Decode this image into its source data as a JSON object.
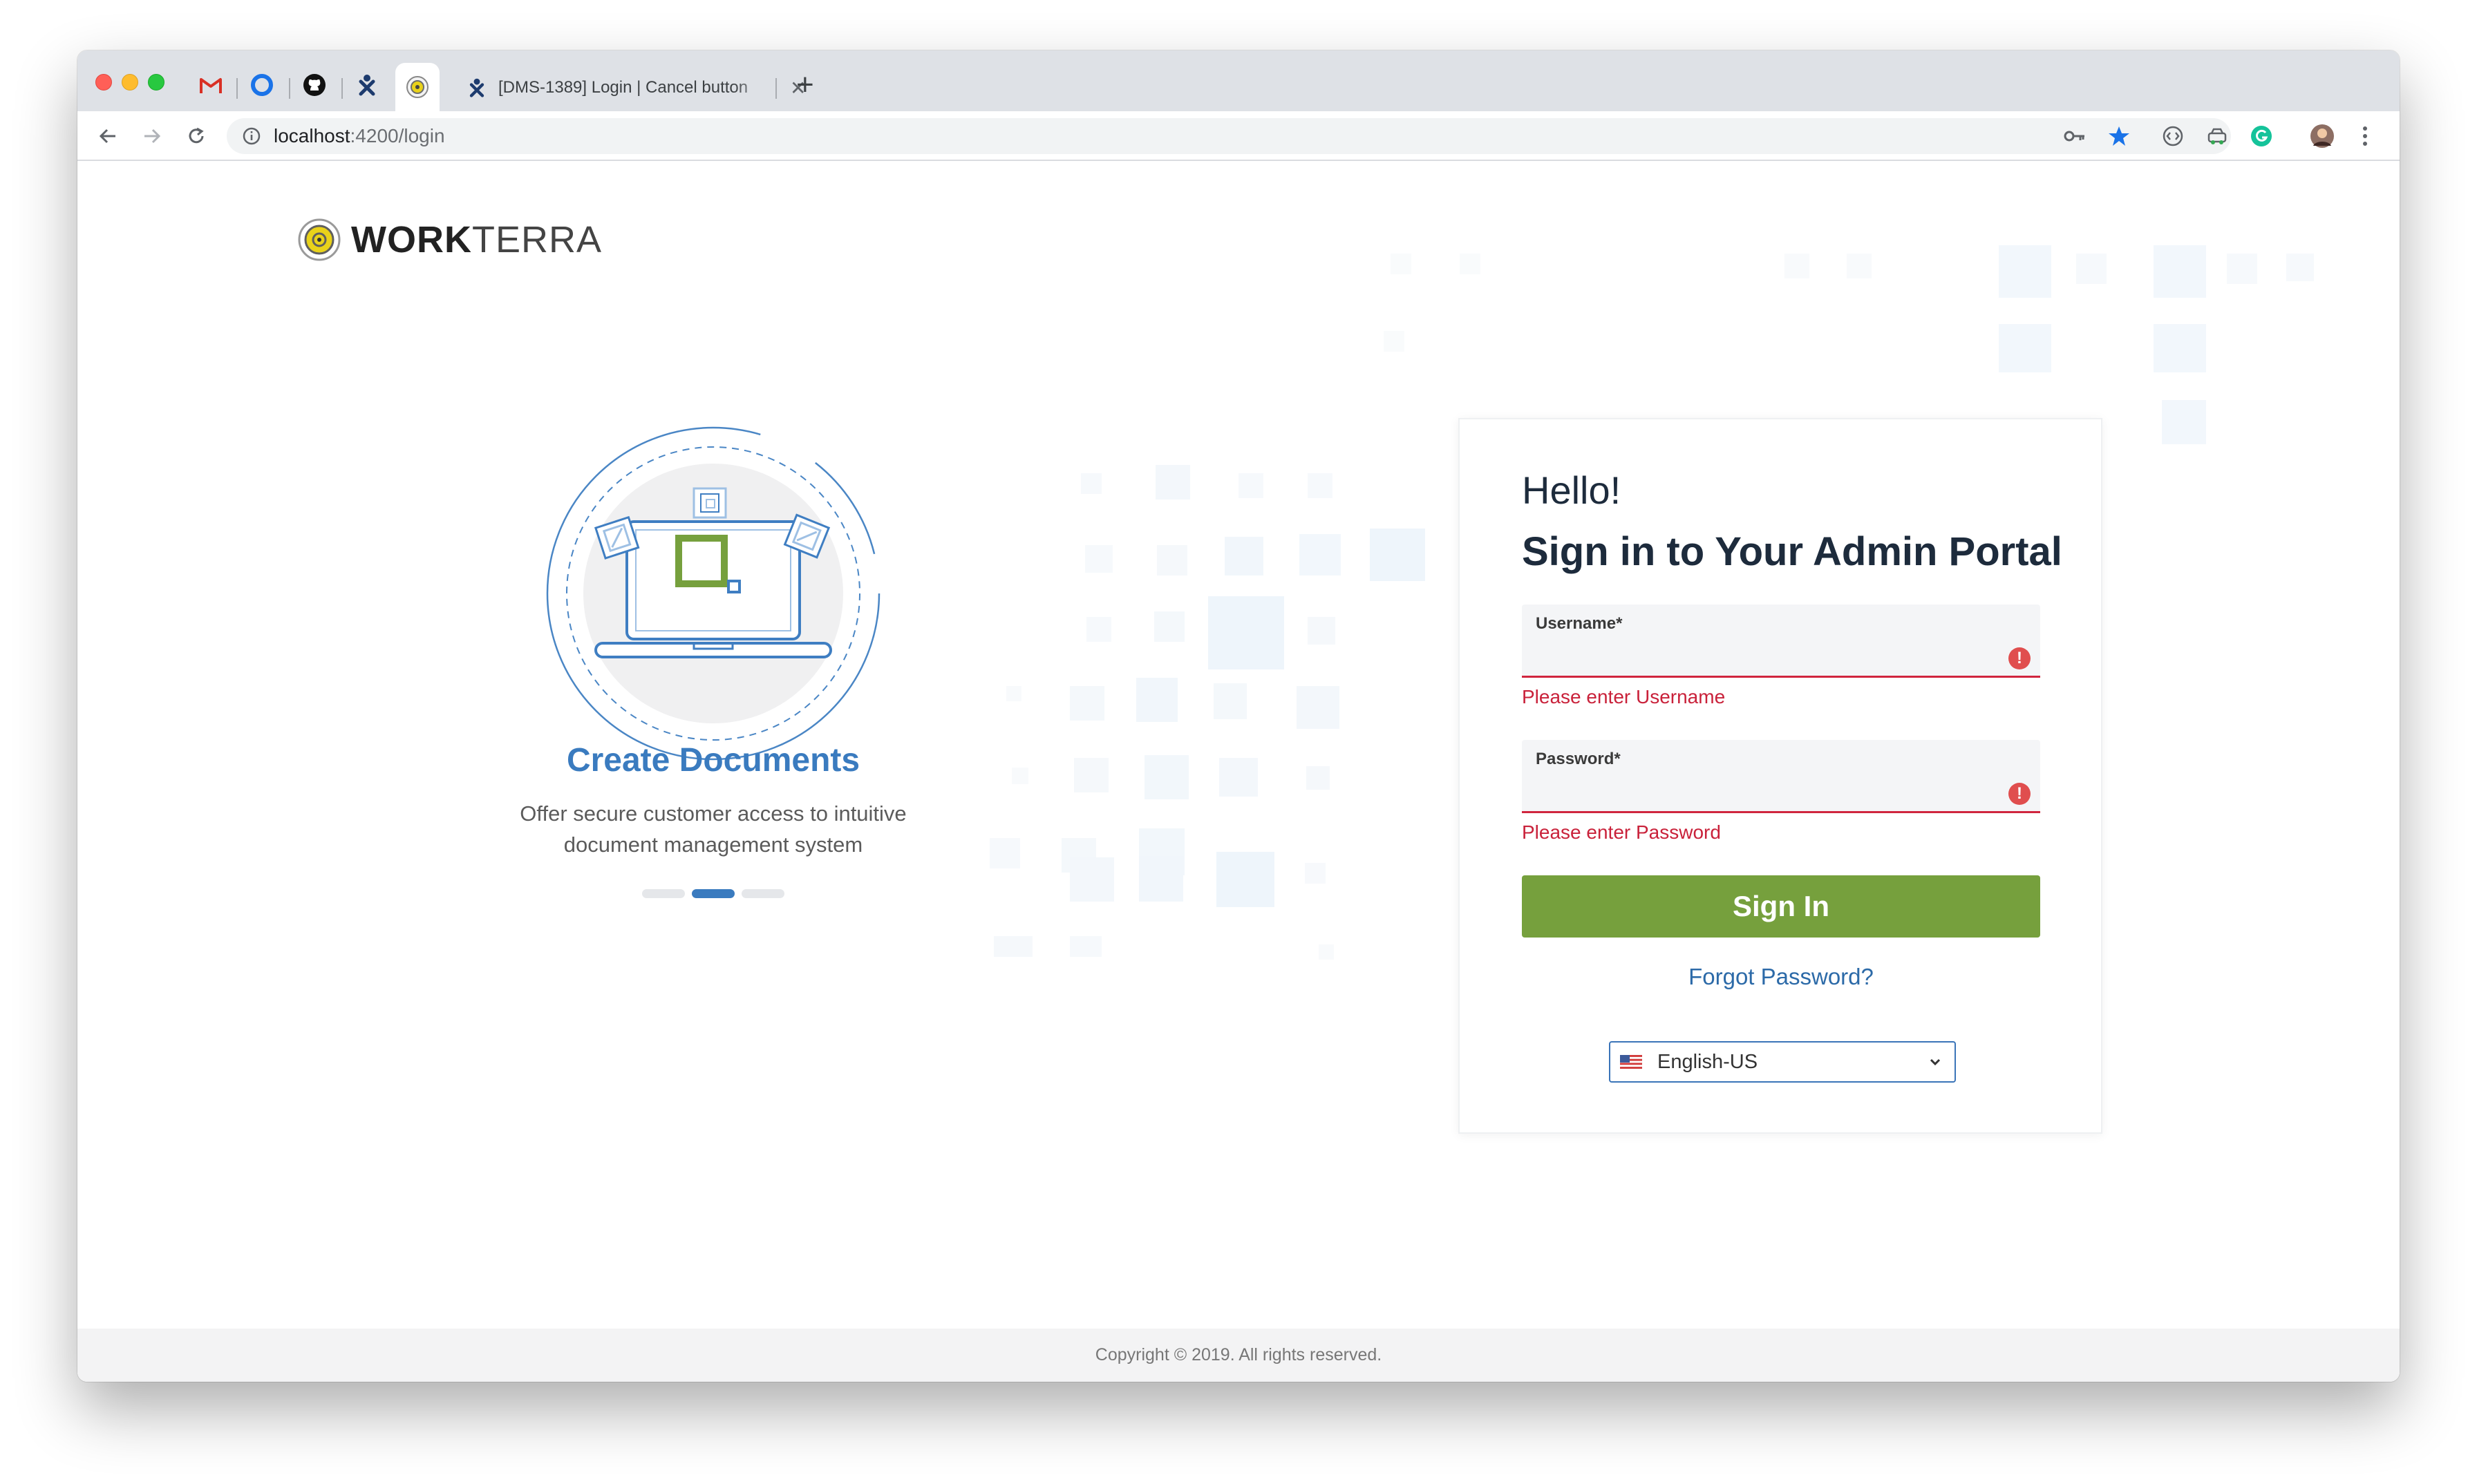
{
  "browser": {
    "tab_title": "[DMS-1389] Login | Cancel button",
    "url_host": "localhost",
    "url_path": ":4200/login",
    "pinned_tabs": [
      "gmail-icon",
      "circle-app-icon",
      "github-icon",
      "jira-icon"
    ],
    "active_tab_icon": "workterra-favicon"
  },
  "logo": {
    "bold": "WORK",
    "light": "TERRA"
  },
  "carousel": {
    "title": "Create Documents",
    "description": "Offer secure customer access to intuitive document management system",
    "slide_count": 3,
    "active_slide": 2
  },
  "login": {
    "greeting": "Hello!",
    "heading": "Sign in to Your Admin Portal",
    "username_label": "Username*",
    "username_value": "",
    "username_error": "Please enter Username",
    "password_label": "Password*",
    "password_value": "",
    "password_error": "Please enter Password",
    "error_glyph": "!",
    "signin_label": "Sign In",
    "forgot_label": "Forgot Password?",
    "language": "English-US"
  },
  "footer": {
    "copyright": "Copyright © 2019. All rights reserved."
  },
  "colors": {
    "brand_blue": "#3a7bbf",
    "brand_green": "#76a03d",
    "error_red": "#c9213a",
    "heading_dark": "#1d2b3c"
  }
}
